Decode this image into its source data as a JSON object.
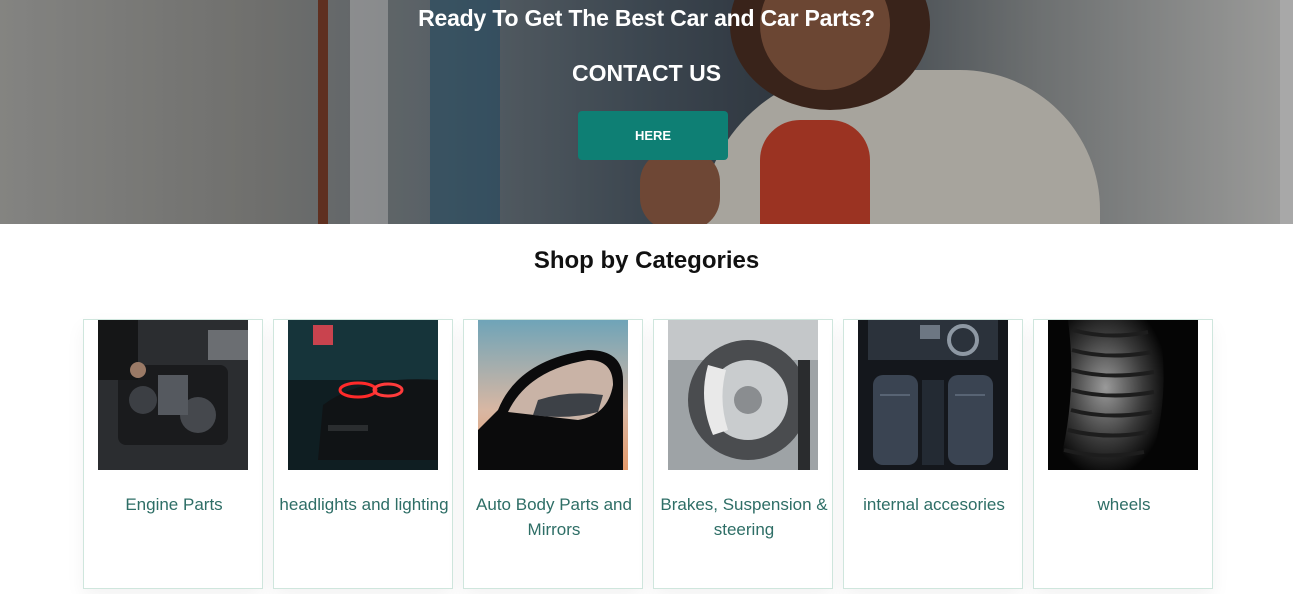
{
  "hero": {
    "title": "Ready To Get The Best Car and Car Parts?",
    "subtitle": "CONTACT US",
    "button_label": "HERE",
    "accent_color": "#0e7f74"
  },
  "categories": {
    "title": "Shop by Categories",
    "label_color": "#2e6e66",
    "items": [
      {
        "label": "Engine Parts",
        "image": "engine-image"
      },
      {
        "label": "headlights and lighting",
        "image": "headlight-image"
      },
      {
        "label": "Auto Body Parts and Mirrors",
        "image": "mirror-image"
      },
      {
        "label": "Brakes, Suspension & steering",
        "image": "brake-image"
      },
      {
        "label": "internal accesories",
        "image": "interior-image"
      },
      {
        "label": "wheels",
        "image": "tire-image"
      }
    ]
  }
}
